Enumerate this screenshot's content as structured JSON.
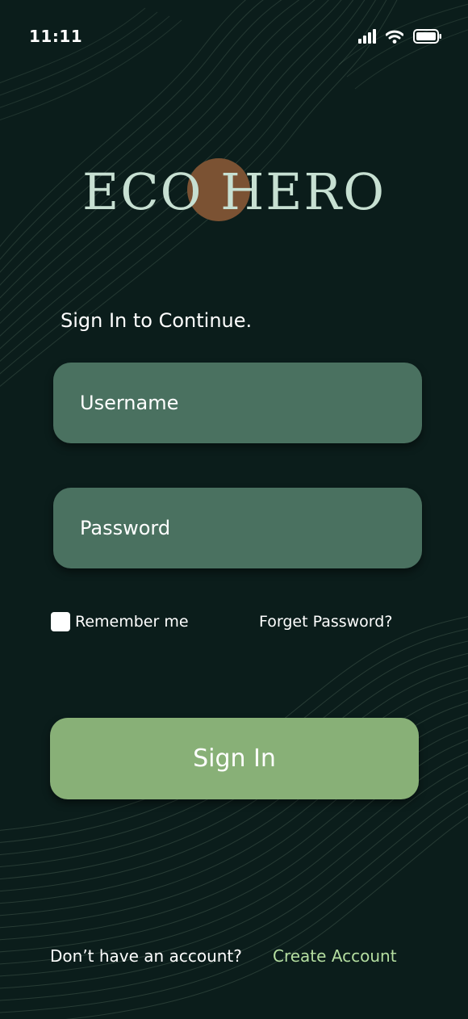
{
  "status_bar": {
    "time": "11:11",
    "icons": [
      "signal-icon",
      "wifi-icon",
      "battery-icon"
    ]
  },
  "logo": {
    "text": "ECO HERO",
    "text_color": "#c7e0d2",
    "circle_color": "#7b5233"
  },
  "form": {
    "heading": "Sign In to Continue.",
    "username_placeholder": "Username",
    "password_placeholder": "Password",
    "remember_label": "Remember me",
    "forgot_label": "Forget Password?",
    "signin_label": "Sign In",
    "field_color": "#4a7160",
    "button_color": "#88b077"
  },
  "footer": {
    "question": "Don’t have an account?",
    "create_label": "Create Account",
    "create_color": "#b5dfa1"
  },
  "theme": {
    "background": "#0b1d1b"
  }
}
